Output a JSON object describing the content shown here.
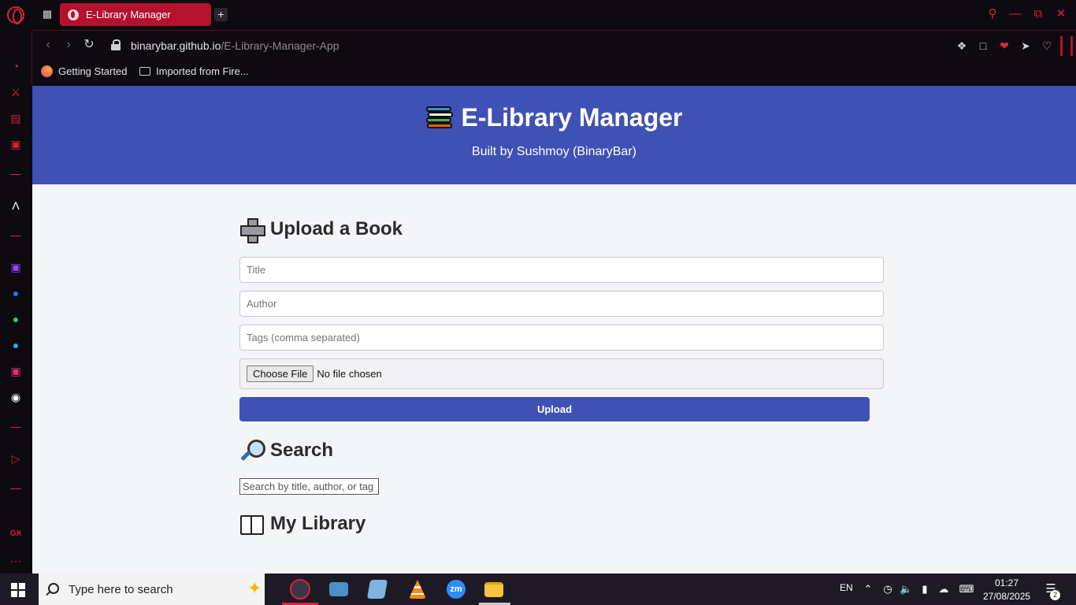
{
  "browser": {
    "tab_title": "E-Library Manager",
    "url_host": "binarybar.github.io",
    "url_path": "/E-Library-Manager-App",
    "bookmarks": [
      {
        "label": "Getting Started"
      },
      {
        "label": "Imported from Fire..."
      }
    ],
    "accent_color": "#d8233b"
  },
  "header": {
    "title": "E-Library Manager",
    "subtitle": "Built by Sushmoy (BinaryBar)",
    "background_color": "#3f51b5"
  },
  "upload": {
    "heading": "Upload a Book",
    "title_placeholder": "Title",
    "author_placeholder": "Author",
    "tags_placeholder": "Tags (comma separated)",
    "file_button_label": "Choose File",
    "file_status": "No file chosen",
    "submit_label": "Upload"
  },
  "search": {
    "heading": "Search",
    "placeholder": "Search by title, author, or tag"
  },
  "library": {
    "heading": "My Library"
  },
  "taskbar": {
    "search_placeholder": "Type here to search",
    "language": "EN",
    "time": "01:27",
    "date": "27/08/2025",
    "notification_count": "2"
  }
}
